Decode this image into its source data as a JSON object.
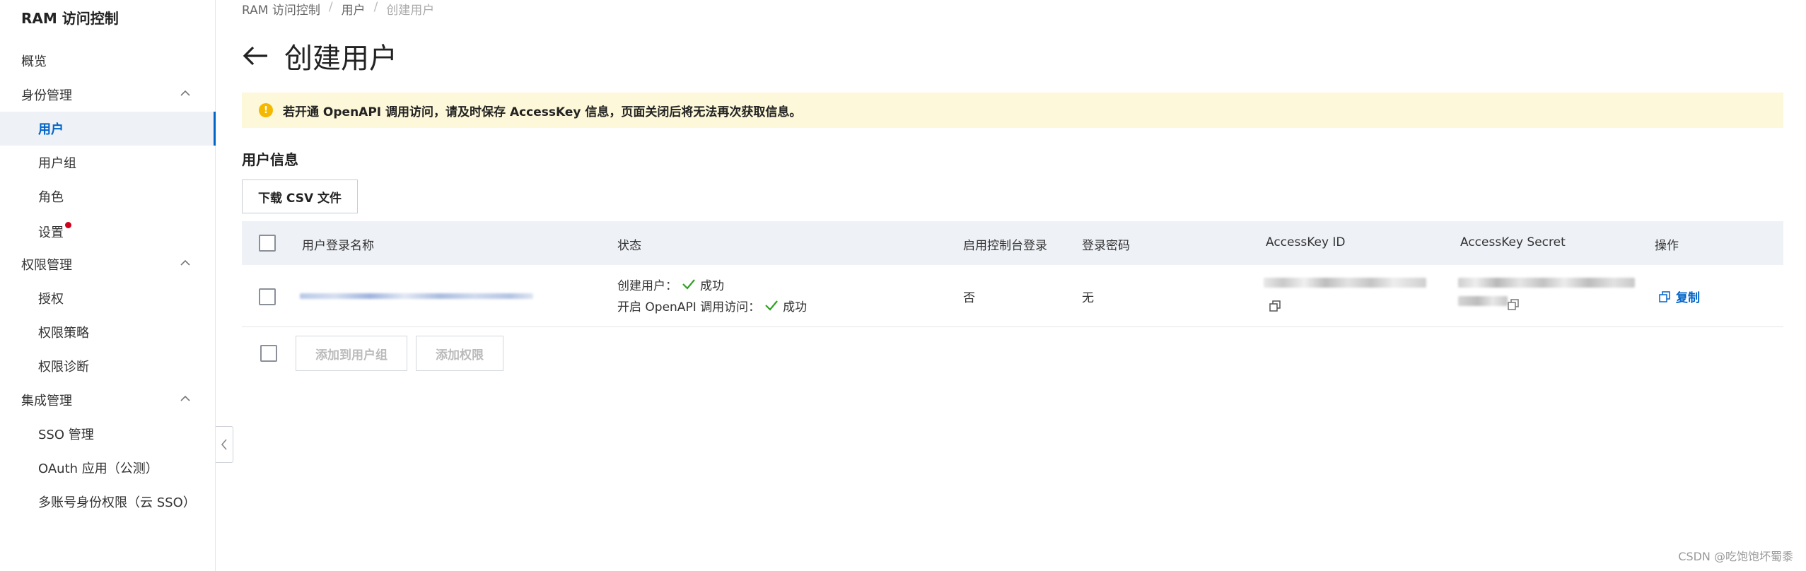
{
  "sidebar": {
    "title": "RAM 访问控制",
    "items": [
      {
        "label": "概览"
      },
      {
        "label": "身份管理"
      },
      {
        "label": "用户"
      },
      {
        "label": "用户组"
      },
      {
        "label": "角色"
      },
      {
        "label": "设置"
      },
      {
        "label": "权限管理"
      },
      {
        "label": "授权"
      },
      {
        "label": "权限策略"
      },
      {
        "label": "权限诊断"
      },
      {
        "label": "集成管理"
      },
      {
        "label": "SSO 管理"
      },
      {
        "label": "OAuth 应用（公测）"
      },
      {
        "label": "多账号身份权限（云 SSO）"
      }
    ]
  },
  "breadcrumb": [
    "RAM 访问控制",
    "用户",
    "创建用户"
  ],
  "page_title": "创建用户",
  "alert": "若开通 OpenAPI 调用访问，请及时保存 AccessKey 信息，页面关闭后将无法再次获取信息。",
  "section_title": "用户信息",
  "download_button": "下载 CSV 文件",
  "table": {
    "headers": [
      "用户登录名称",
      "状态",
      "启用控制台登录",
      "登录密码",
      "AccessKey ID",
      "AccessKey Secret",
      "操作"
    ],
    "row": {
      "status_create_label": "创建用户：",
      "status_create_value": "成功",
      "status_openapi_label": "开启 OpenAPI 调用访问：",
      "status_openapi_value": "成功",
      "console_login": "否",
      "password": "无",
      "action": "复制"
    }
  },
  "footer_buttons": {
    "add_to_group": "添加到用户组",
    "add_permission": "添加权限"
  },
  "watermark": "CSDN @吃饱饱坏蜀黍",
  "colors": {
    "accent": "#0064c8",
    "alert_bg": "#fdf8d9",
    "success": "#2ea121",
    "header_bg": "#eef1f6"
  }
}
